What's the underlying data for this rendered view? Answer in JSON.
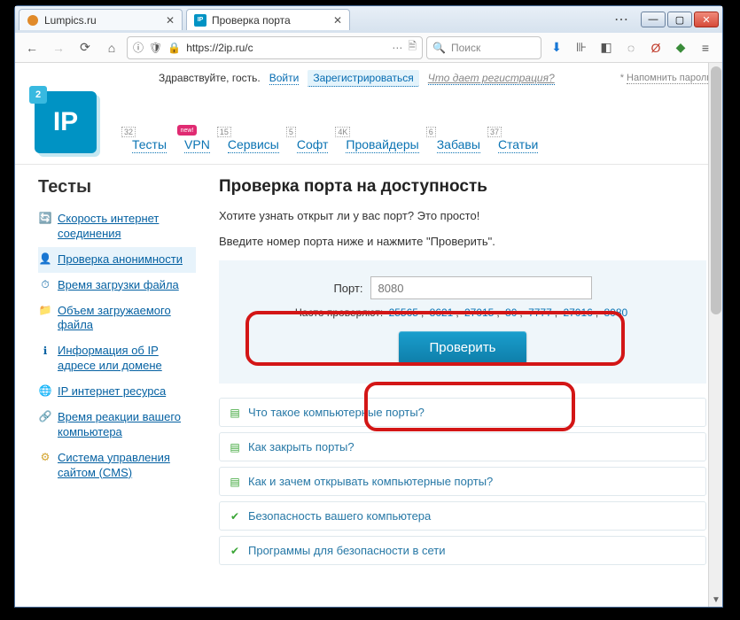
{
  "tabs": [
    {
      "title": "Lumpics.ru",
      "favicon_color": "#e08a2a"
    },
    {
      "title": "Проверка порта",
      "favicon_text": "IP",
      "favicon_bg": "#0093c4"
    }
  ],
  "nav": {
    "url_display": "https://2ip.ru/c",
    "search_placeholder": "Поиск"
  },
  "topbar": {
    "greeting": "Здравствуйте, гость.",
    "login": "Войти",
    "register": "Зарегистрироваться",
    "what_gives": "Что дает регистрация?",
    "remind": "Напомнить пароль"
  },
  "logo": {
    "square": "2",
    "text": "IP"
  },
  "menu": [
    {
      "label": "Тесты",
      "sup": "32"
    },
    {
      "label": "VPN",
      "sup": "new!"
    },
    {
      "label": "Сервисы",
      "sup": "15"
    },
    {
      "label": "Софт",
      "sup": "5"
    },
    {
      "label": "Провайдеры",
      "sup": "4K"
    },
    {
      "label": "Забавы",
      "sup": "6"
    },
    {
      "label": "Статьи",
      "sup": "37"
    }
  ],
  "sidebar": {
    "heading": "Тесты",
    "items": [
      {
        "label": "Скорость интернет соединения",
        "icon": "🔄",
        "active": false
      },
      {
        "label": "Проверка анонимности",
        "icon": "👤",
        "active": true
      },
      {
        "label": "Время загрузки файла",
        "icon": "⏱",
        "active": false
      },
      {
        "label": "Объем загружаемого файла",
        "icon": "📁",
        "active": false
      },
      {
        "label": "Информация об IP адресе или домене",
        "icon": "ℹ",
        "active": false
      },
      {
        "label": "IP интернет ресурса",
        "icon": "🌐",
        "active": false
      },
      {
        "label": "Время реакции вашего компьютера",
        "icon": "🔗",
        "active": false
      },
      {
        "label": "Система управления сайтом (CMS)",
        "icon": "⚙",
        "active": false
      }
    ]
  },
  "main": {
    "h1": "Проверка порта на доступность",
    "p1": "Хотите узнать открыт ли у вас порт? Это просто!",
    "p2": "Введите номер порта ниже и нажмите \"Проверить\".",
    "port_label": "Порт:",
    "port_placeholder": "8080",
    "freq_label": "Часто проверяют: ",
    "freq_ports": [
      "25565",
      "8621",
      "27015",
      "80",
      "7777",
      "27016",
      "8080"
    ],
    "check_btn": "Проверить"
  },
  "accordion": [
    {
      "icon": "green",
      "label": "Что такое компьютерные порты?"
    },
    {
      "icon": "green",
      "label": "Как закрыть порты?"
    },
    {
      "icon": "green",
      "label": "Как и зачем открывать компьютерные порты?"
    },
    {
      "icon": "check",
      "label": "Безопасность вашего компьютера"
    },
    {
      "icon": "check",
      "label": "Программы для безопасности в сети"
    }
  ]
}
